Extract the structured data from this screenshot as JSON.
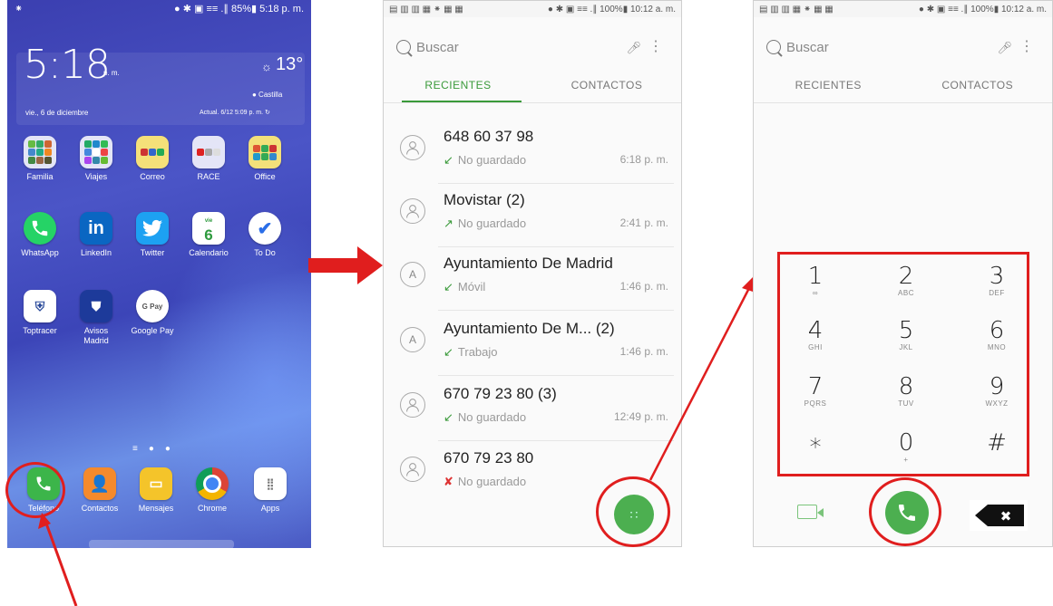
{
  "home": {
    "status_left": "⁕",
    "status_right": "● ✱ ▣ ≡≡ .∥ 85%▮ 5:18 p. m.",
    "clock": "5:18",
    "clock_ampm": "p. m.",
    "date": "vie., 6 de diciembre",
    "temperature": "13°",
    "location": "● Castilla",
    "updated": "Actual. 6/12 5:09 p. m. ↻",
    "apps": [
      {
        "label": "Familia"
      },
      {
        "label": "Viajes"
      },
      {
        "label": "Correo"
      },
      {
        "label": "RACE"
      },
      {
        "label": "Office"
      },
      {
        "label": "WhatsApp"
      },
      {
        "label": "LinkedIn"
      },
      {
        "label": "Twitter"
      },
      {
        "label": "Calendario"
      },
      {
        "label": "To Do"
      },
      {
        "label": "Toptracer"
      },
      {
        "label": "Avisos Madrid"
      },
      {
        "label": "Google Pay"
      }
    ],
    "calendar_day": "6",
    "calendar_weekday": "vie",
    "linkedin_glyph": "in",
    "gpay_glyph": "G Pay",
    "dock": [
      {
        "label": "Teléfono"
      },
      {
        "label": "Contactos"
      },
      {
        "label": "Mensajes"
      },
      {
        "label": "Chrome"
      },
      {
        "label": "Apps"
      }
    ]
  },
  "recents": {
    "status_left": "▤ ▥ ▥ ▦ ⁕ ▦ ▦",
    "status_right": "● ✱ ▣ ≡≡ .∥ 100%▮ 10:12 a. m.",
    "search_placeholder": "Buscar",
    "tabs": [
      "RECIENTES",
      "CONTACTOS"
    ],
    "calls": [
      {
        "avatar": "",
        "name": "648 60 37 98",
        "sub": "No guardado",
        "type_icon": "↙",
        "time": "6:18 p. m."
      },
      {
        "avatar": "",
        "name": "Movistar (2)",
        "sub": "No guardado",
        "type_icon": "↗",
        "time": "2:41 p. m."
      },
      {
        "avatar": "A",
        "name": "Ayuntamiento De Madrid",
        "sub": "Móvil",
        "type_icon": "↙",
        "time": "1:46 p. m."
      },
      {
        "avatar": "A",
        "name": "Ayuntamiento De M... (2)",
        "sub": "Trabajo",
        "type_icon": "↙",
        "time": "1:46 p. m."
      },
      {
        "avatar": "",
        "name": "670 79 23 80 (3)",
        "sub": "No guardado",
        "type_icon": "↙",
        "time": "12:49 p. m."
      },
      {
        "avatar": "",
        "name": "670 79 23 80",
        "sub": "No guardado",
        "type_icon": "✘",
        "time": ""
      }
    ],
    "fab_glyph": "∷"
  },
  "dialer": {
    "status_left": "▤ ▥ ▥ ▦ ⁕ ▦ ▦",
    "status_right": "● ✱ ▣ ≡≡ .∥ 100%▮ 10:12 a. m.",
    "search_placeholder": "Buscar",
    "tabs": [
      "RECIENTES",
      "CONTACTOS"
    ],
    "keys": [
      {
        "digit": "1",
        "letters": "∞"
      },
      {
        "digit": "2",
        "letters": "ABC"
      },
      {
        "digit": "3",
        "letters": "DEF"
      },
      {
        "digit": "4",
        "letters": "GHI"
      },
      {
        "digit": "5",
        "letters": "JKL"
      },
      {
        "digit": "6",
        "letters": "MNO"
      },
      {
        "digit": "7",
        "letters": "PQRS"
      },
      {
        "digit": "8",
        "letters": "TUV"
      },
      {
        "digit": "9",
        "letters": "WXYZ"
      },
      {
        "digit": "∗",
        "letters": ""
      },
      {
        "digit": "0",
        "letters": "+"
      },
      {
        "digit": "#",
        "letters": ""
      }
    ],
    "backspace_glyph": "✖"
  },
  "colors": {
    "accent_green": "#3a9a3a",
    "highlight_red": "#e01e1e",
    "call_green": "#4caf50"
  }
}
